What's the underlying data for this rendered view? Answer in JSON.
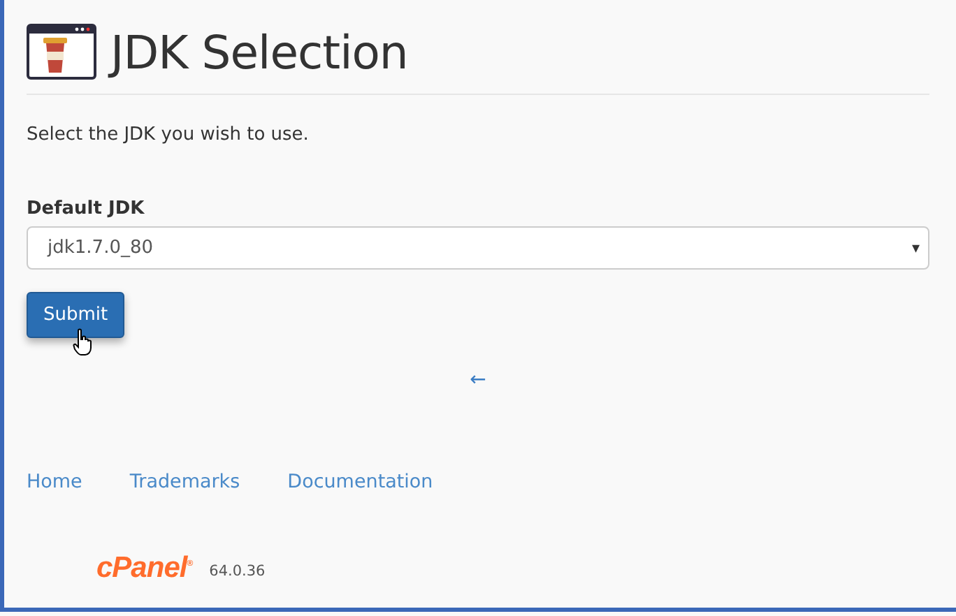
{
  "header": {
    "title": "JDK Selection"
  },
  "intro": "Select the JDK you wish to use.",
  "form": {
    "label": "Default JDK",
    "select_value": "jdk1.7.0_80",
    "caret": "▾",
    "submit": "Submit"
  },
  "back_arrow": "←",
  "footer_links": [
    "Home",
    "Trademarks",
    "Documentation"
  ],
  "brand": {
    "logo": "cPanel",
    "mark": "®",
    "version": "64.0.36"
  }
}
